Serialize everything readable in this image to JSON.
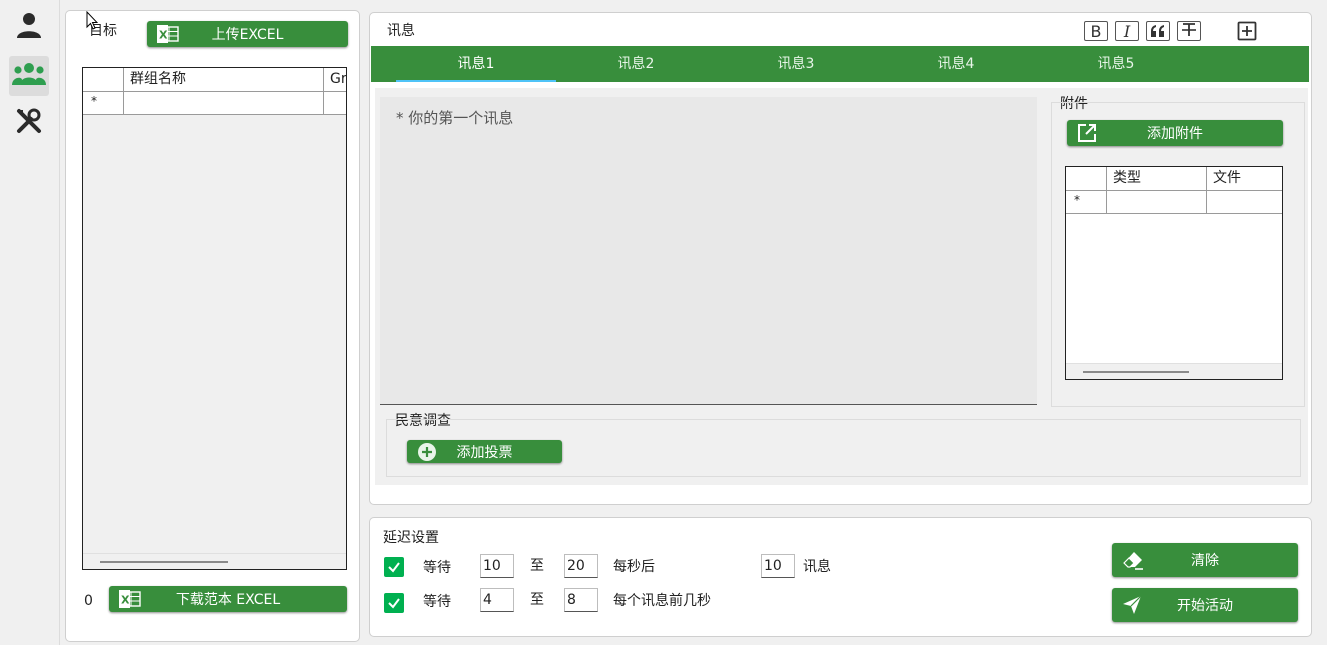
{
  "sidebar": {
    "items": [
      {
        "icon": "user-icon",
        "active": false
      },
      {
        "icon": "group-icon",
        "active": true
      },
      {
        "icon": "tools-icon",
        "active": false
      }
    ],
    "accent": "#2e9e4f"
  },
  "targets": {
    "title": "目标",
    "upload_label": "上传EXCEL",
    "columns": [
      "群组名称",
      "Gr"
    ],
    "new_row_marker": "*",
    "count": "0",
    "download_label": "下载范本 EXCEL"
  },
  "message": {
    "title": "讯息",
    "format_buttons": [
      {
        "icon": "bold-icon",
        "glyph": "B"
      },
      {
        "icon": "italic-icon",
        "glyph": "I"
      },
      {
        "icon": "quote-icon",
        "glyph": "❝"
      },
      {
        "icon": "strikethrough-icon",
        "glyph": "T"
      }
    ],
    "add_icon": "plus-square-icon",
    "tabs": [
      "讯息1",
      "讯息2",
      "讯息3",
      "讯息4",
      "讯息5"
    ],
    "active_tab": 0,
    "editor_placeholder": "* 你的第一个讯息",
    "attachments": {
      "title": "附件",
      "add_label": "添加附件",
      "columns": [
        "类型",
        "文件"
      ],
      "new_row_marker": "*"
    },
    "poll": {
      "title": "民意调查",
      "add_label": "添加投票"
    }
  },
  "delay": {
    "title": "延迟设置",
    "row1": {
      "checked": true,
      "wait": "等待",
      "from": "10",
      "to_word": "至",
      "to": "20",
      "after": "每秒后",
      "count": "10",
      "unit": "讯息"
    },
    "row2": {
      "checked": true,
      "wait": "等待",
      "from": "4",
      "to_word": "至",
      "to": "8",
      "after": "每个讯息前几秒"
    }
  },
  "actions": {
    "clear_label": "清除",
    "start_label": "开始活动"
  },
  "colors": {
    "button_green": "#388e3c",
    "checkbox_green": "#00b050",
    "tab_underline": "#4fc3f7"
  }
}
